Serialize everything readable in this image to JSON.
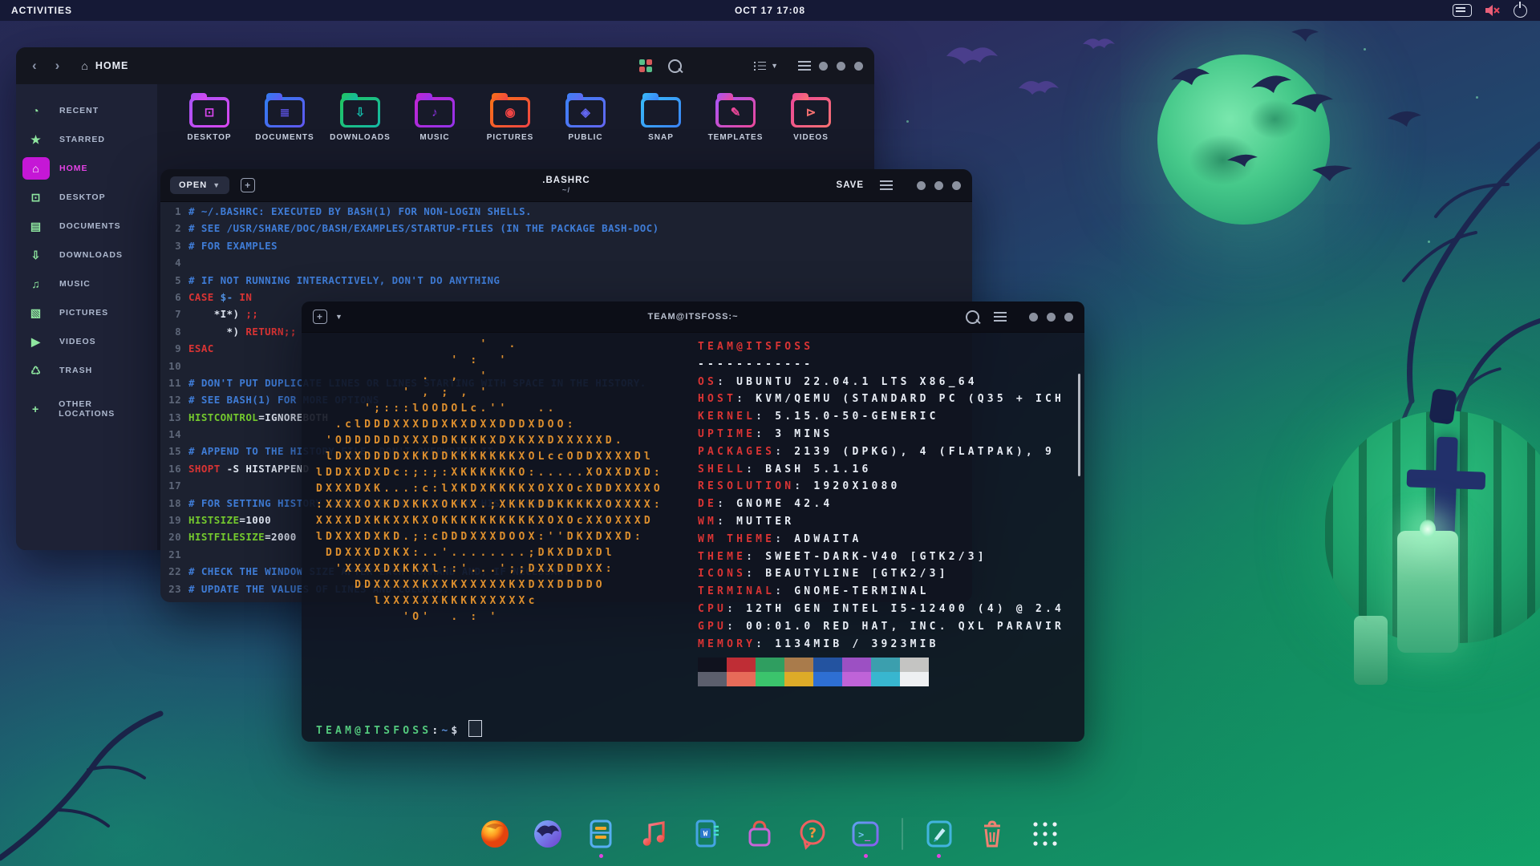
{
  "topbar": {
    "activities": "Activities",
    "clock": "Oct 17 17:08",
    "tray_icons": [
      "keyboard-icon",
      "volume-muted-icon",
      "power-icon"
    ]
  },
  "files_window": {
    "location": "Home",
    "sidebar": [
      {
        "label": "Recent",
        "icon": "clock-icon",
        "glyph": "◔",
        "active": false
      },
      {
        "label": "Starred",
        "icon": "star-icon",
        "glyph": "★",
        "active": false
      },
      {
        "label": "Home",
        "icon": "home-icon",
        "glyph": "⌂",
        "active": true
      },
      {
        "label": "Desktop",
        "icon": "desktop-icon",
        "glyph": "⊡",
        "active": false
      },
      {
        "label": "Documents",
        "icon": "documents-icon",
        "glyph": "▤",
        "active": false
      },
      {
        "label": "Downloads",
        "icon": "downloads-icon",
        "glyph": "⇩",
        "active": false
      },
      {
        "label": "Music",
        "icon": "music-icon",
        "glyph": "♫",
        "active": false
      },
      {
        "label": "Pictures",
        "icon": "pictures-icon",
        "glyph": "▧",
        "active": false
      },
      {
        "label": "Videos",
        "icon": "videos-icon",
        "glyph": "▶",
        "active": false
      },
      {
        "label": "Trash",
        "icon": "trash-icon",
        "glyph": "♺",
        "active": false
      },
      {
        "label": "Other Locations",
        "icon": "plus-icon",
        "glyph": "+",
        "active": false,
        "other": true
      }
    ],
    "folders": [
      {
        "label": "Desktop",
        "glyph": "⊡",
        "c1": "#a855f7",
        "c2": "#d946ef"
      },
      {
        "label": "Documents",
        "glyph": "≣",
        "c1": "#2f7ef0",
        "c2": "#6157f0"
      },
      {
        "label": "Downloads",
        "glyph": "⇩",
        "c1": "#22c55e",
        "c2": "#14b8a6"
      },
      {
        "label": "Music",
        "glyph": "♪",
        "c1": "#c026d3",
        "c2": "#9333ea"
      },
      {
        "label": "Pictures",
        "glyph": "◉",
        "c1": "#f97316",
        "c2": "#ef4444"
      },
      {
        "label": "Public",
        "glyph": "◈",
        "c1": "#3b82f6",
        "c2": "#6366f1"
      },
      {
        "label": "Snap",
        "glyph": "",
        "c1": "#38bdf8",
        "c2": "#3b82f6"
      },
      {
        "label": "Templates",
        "glyph": "✎",
        "c1": "#a855f7",
        "c2": "#ec4899"
      },
      {
        "label": "Videos",
        "glyph": "⊳",
        "c1": "#ec4899",
        "c2": "#f87171"
      }
    ],
    "grid_dot_colors": [
      "#58c08a",
      "#d65a5a",
      "#d65a5a",
      "#58c08a"
    ]
  },
  "editor_window": {
    "open_label": "Open",
    "title": ".bashrc",
    "subtitle": "~/",
    "save_label": "Save",
    "lines": [
      {
        "n": "1",
        "seg": [
          [
            "c",
            "# ~/.bashrc: executed by bash(1) for non-login shells."
          ]
        ]
      },
      {
        "n": "2",
        "seg": [
          [
            "c",
            "# see /usr/share/doc/bash/examples/startup-files (in the package bash-doc)"
          ]
        ]
      },
      {
        "n": "3",
        "seg": [
          [
            "c",
            "# for examples"
          ]
        ]
      },
      {
        "n": "4",
        "seg": []
      },
      {
        "n": "5",
        "seg": [
          [
            "c",
            "# If not running interactively, don't do anything"
          ]
        ]
      },
      {
        "n": "6",
        "seg": [
          [
            "k",
            "case "
          ],
          [
            "b",
            "$-"
          ],
          [
            "k",
            " in"
          ]
        ]
      },
      {
        "n": "7",
        "seg": [
          [
            "p",
            "    *i*) "
          ],
          [
            "k",
            ";;"
          ]
        ]
      },
      {
        "n": "8",
        "seg": [
          [
            "p",
            "      *) "
          ],
          [
            "k",
            "return;;"
          ]
        ]
      },
      {
        "n": "9",
        "seg": [
          [
            "k",
            "esac"
          ]
        ]
      },
      {
        "n": "10",
        "seg": []
      },
      {
        "n": "11",
        "seg": [
          [
            "c",
            "# don't put duplicate lines or lines starting with space in the history."
          ]
        ]
      },
      {
        "n": "12",
        "seg": [
          [
            "c",
            "# see bash(1) for more options"
          ]
        ]
      },
      {
        "n": "13",
        "seg": [
          [
            "v",
            "HISTCONTROL"
          ],
          [
            "p",
            "=ignoreboth"
          ]
        ]
      },
      {
        "n": "14",
        "seg": []
      },
      {
        "n": "15",
        "seg": [
          [
            "c",
            "# append to the history file, don't overwrite it"
          ]
        ]
      },
      {
        "n": "16",
        "seg": [
          [
            "k",
            "shopt"
          ],
          [
            "p",
            " -s histappend"
          ]
        ]
      },
      {
        "n": "17",
        "seg": []
      },
      {
        "n": "18",
        "seg": [
          [
            "c",
            "# for setting history length see HISTSIZE and HISTFILESIZE in bash(1)"
          ]
        ]
      },
      {
        "n": "19",
        "seg": [
          [
            "v",
            "HISTSIZE"
          ],
          [
            "p",
            "=1000"
          ]
        ]
      },
      {
        "n": "20",
        "seg": [
          [
            "v",
            "HISTFILESIZE"
          ],
          [
            "p",
            "=2000"
          ]
        ]
      },
      {
        "n": "21",
        "seg": []
      },
      {
        "n": "22",
        "seg": [
          [
            "c",
            "# check the window size after each command and, if necessary,"
          ]
        ]
      },
      {
        "n": "23",
        "seg": [
          [
            "c",
            "# update the values of LINES and COLUMNS."
          ]
        ]
      }
    ]
  },
  "terminal_window": {
    "title": "team@itsfoss:~",
    "ascii_art": [
      "                 '  .",
      "              ' :  '",
      "           .  ,  '",
      "         ' , ; , '",
      "     ';:::lOODOLc.''   ..",
      "  .clDDDXXXDDXKXDXXDDDXDOO:",
      " 'ODDDDDDXXXDDKKKKXDXKXXDXXXXXD.",
      " lDXXDDDDXKKDDKKKKKKKXOLccODDXXXXDl",
      "lDDXXDXDc:;:;:XKKKKKKO:.....XOXXDXD:",
      "DXXXDXK...:c:lXKDXKKKKXOXXOcXDDXXXXO",
      ":XXXXOXKDXKKXOKKX.;XKKKDDKKKKXOXXXX:",
      "XXXXDXKKXXKXOKKKKKKKKKKXOXOcXXOXXXD",
      "lDXXXDXKD.;:cDDDXXXDOOX:''DKXDXXD:",
      " DDXXXDXKX:..'........;DKXDDXDl",
      "  'XXXXDXKKXl::'...';;DXXDDDXX:",
      "    DDXXXXXKXXKXXXXXKXDXXDDDDO",
      "      lXXXXXXKKKKXXXXXc",
      "         'O'  . : '"
    ],
    "user_host": "team@itsfoss",
    "underline": "------------",
    "info": [
      [
        "OS",
        "Ubuntu 22.04.1 LTS x86_64"
      ],
      [
        "Host",
        "KVM/QEMU (Standard PC (Q35 + ICH"
      ],
      [
        "Kernel",
        "5.15.0-50-generic"
      ],
      [
        "Uptime",
        "3 mins"
      ],
      [
        "Packages",
        "2139 (dpkg), 4 (flatpak), 9"
      ],
      [
        "Shell",
        "bash 5.1.16"
      ],
      [
        "Resolution",
        "1920x1080"
      ],
      [
        "DE",
        "GNOME 42.4"
      ],
      [
        "WM",
        "Mutter"
      ],
      [
        "WM Theme",
        "Adwaita"
      ],
      [
        "Theme",
        "Sweet-Dark-v40 [GTK2/3]"
      ],
      [
        "Icons",
        "BeautyLine [GTK2/3]"
      ],
      [
        "Terminal",
        "gnome-terminal"
      ],
      [
        "CPU",
        "12th Gen Intel i5-12400 (4) @ 2.4"
      ],
      [
        "GPU",
        "00:01.0 Red Hat, Inc. QXL paravir"
      ],
      [
        "Memory",
        "1134MiB / 3923MiB"
      ]
    ],
    "palette_row1": [
      "#10121e",
      "#bf2d35",
      "#2f9e60",
      "#a97b4b",
      "#2353a0",
      "#9c50c3",
      "#3b9fae",
      "#c4c4c2"
    ],
    "palette_row2": [
      "#5c5f6d",
      "#e76b59",
      "#3bc46c",
      "#ddab28",
      "#2e6fd3",
      "#bf63d8",
      "#38b6cf",
      "#eef0f2"
    ],
    "prompt": {
      "user": "team@itsfoss",
      "colon": ":",
      "path": "~",
      "dollar": "$"
    }
  },
  "dock": {
    "items": [
      {
        "app": "firefox",
        "running": false
      },
      {
        "app": "thunderbird",
        "running": false
      },
      {
        "app": "files",
        "running": true
      },
      {
        "app": "rhythmbox",
        "running": false
      },
      {
        "app": "writer",
        "running": false
      },
      {
        "app": "software",
        "running": false
      },
      {
        "app": "help",
        "running": false
      },
      {
        "app": "terminal",
        "running": true
      },
      {
        "separator": true
      },
      {
        "app": "text-editor",
        "running": true
      },
      {
        "app": "trash",
        "running": false
      },
      {
        "app": "show-apps",
        "running": false
      }
    ]
  },
  "colors": {
    "accent_magenta": "#c517d6",
    "running_dot": "#e044e0",
    "ascii_orange": "#dd8f2e",
    "neofetch_label_red": "#d93434",
    "prompt_green": "#53c97d"
  }
}
